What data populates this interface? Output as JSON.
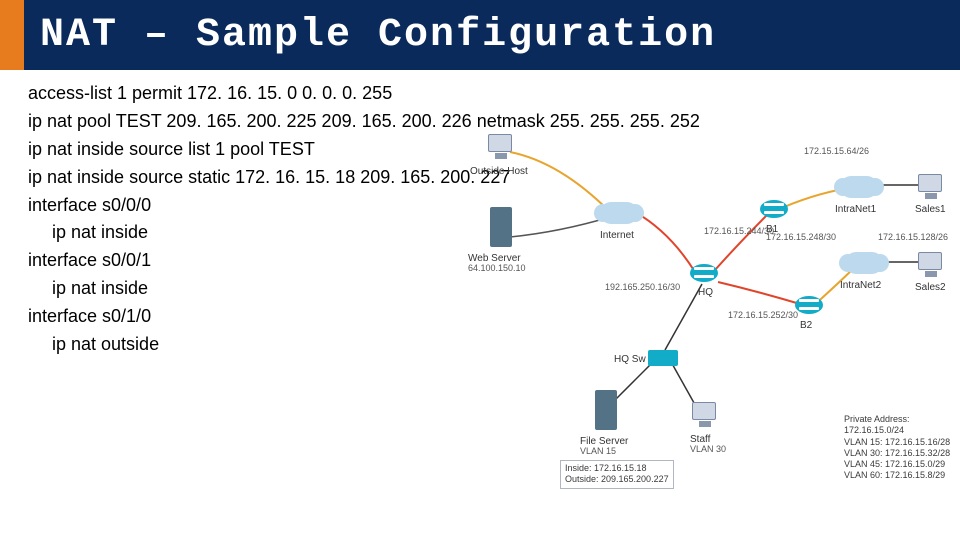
{
  "title": "NAT – Sample Configuration",
  "config": {
    "l1": "access-list 1 permit 172. 16. 15. 0 0. 0. 0. 255",
    "l2": "ip nat pool TEST 209. 165. 200. 225 209. 165. 200. 226 netmask 255. 255. 255. 252",
    "l3": "ip nat inside source list 1 pool TEST",
    "l4": "ip nat inside source static 172. 16. 15. 18 209. 165. 200. 227",
    "l5": "interface s0/0/0",
    "l6": "ip nat inside",
    "l7": "interface s0/0/1",
    "l8": "ip nat inside",
    "l9": "interface s0/1/0",
    "l10": "ip nat outside"
  },
  "diagram": {
    "outside_host": "Outside Host",
    "web_server": "Web Server",
    "web_server_ip": "64.100.150.10",
    "internet": "Internet",
    "intranet1": "IntraNet1",
    "intranet2": "IntraNet2",
    "r_b1": "B1",
    "r_b2": "B2",
    "r_hq": "HQ",
    "sw_hq": "HQ Sw",
    "file_server": "File Server",
    "file_server_vlan": "VLAN 15",
    "staff": "Staff",
    "staff_vlan": "VLAN 30",
    "sales1": "Sales1",
    "sales2": "Sales2",
    "net_b1_top": "172.15.15.64/26",
    "net_sales2": "172.16.15.128/26",
    "net_b1_link": "172.16.15.244/30",
    "net_b2_link": "172.16.15.248/30",
    "net_hq_internet": "192.165.250.16/30",
    "net_hq_lan": "172.16.15.252/30",
    "inside_line": "Inside: 172.16.15.18",
    "outside_line": "Outside: 209.165.200.227",
    "priv_title": "Private Address: 172.16.15.0/24",
    "priv_v15": "VLAN 15: 172.16.15.16/28",
    "priv_v30": "VLAN 30: 172.16.15.32/28",
    "priv_v45": "VLAN 45: 172.16.15.0/29",
    "priv_v60": "VLAN 60: 172.16.15.8/29"
  }
}
